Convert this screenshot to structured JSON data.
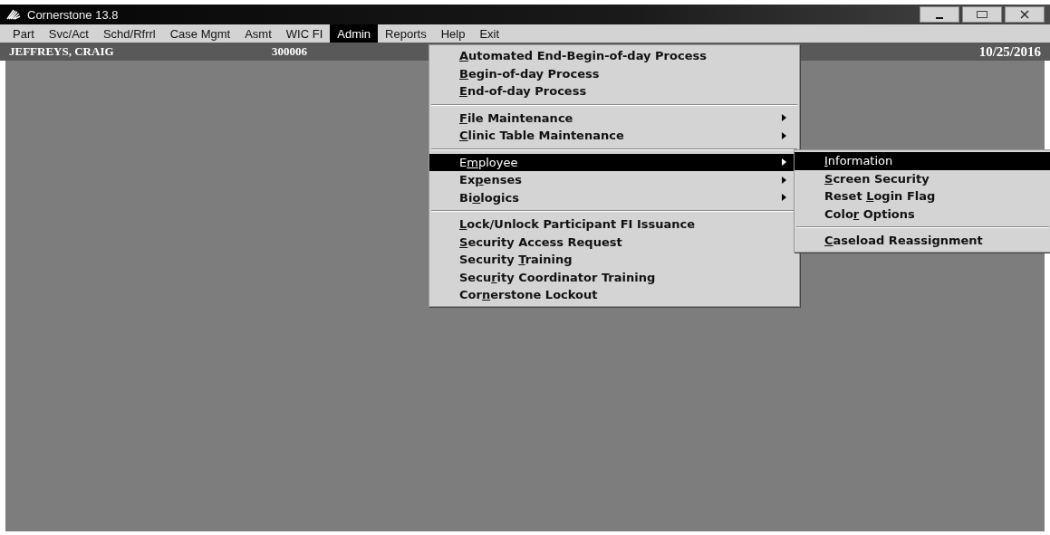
{
  "window": {
    "title": "Cornerstone 13.8"
  },
  "menu_bar": [
    {
      "label": "Part",
      "selected": false
    },
    {
      "label": "Svc/Act",
      "selected": false
    },
    {
      "label": "Schd/Rfrrl",
      "selected": false
    },
    {
      "label": "Case Mgmt",
      "selected": false
    },
    {
      "label": "Asmt",
      "selected": false
    },
    {
      "label": "WIC FI",
      "selected": false
    },
    {
      "label": "Admin",
      "selected": true
    },
    {
      "label": "Reports",
      "selected": false
    },
    {
      "label": "Help",
      "selected": false
    },
    {
      "label": "Exit",
      "selected": false
    }
  ],
  "status_bar": {
    "name": "JEFFREYS, CRAIG",
    "id": "300006",
    "date": "10/25/2016"
  },
  "admin_menu": [
    {
      "kind": "item",
      "key": "A",
      "post": "utomated End-Begin-of-day Process",
      "submenu": false,
      "selected": false
    },
    {
      "kind": "item",
      "key": "B",
      "post": "egin-of-day Process",
      "submenu": false,
      "selected": false
    },
    {
      "kind": "item",
      "key": "E",
      "post": "nd-of-day Process",
      "submenu": false,
      "selected": false
    },
    {
      "kind": "separator"
    },
    {
      "kind": "item",
      "key": "F",
      "post": "ile Maintenance",
      "submenu": true,
      "selected": false
    },
    {
      "kind": "item",
      "key": "C",
      "post": "linic Table Maintenance",
      "submenu": true,
      "selected": false
    },
    {
      "kind": "separator"
    },
    {
      "kind": "item",
      "pre": "E",
      "key": "m",
      "post": "ployee",
      "submenu": true,
      "selected": true
    },
    {
      "kind": "item",
      "pre": "Ex",
      "key": "p",
      "post": "enses",
      "submenu": true,
      "selected": false
    },
    {
      "kind": "item",
      "pre": "Bi",
      "key": "o",
      "post": "logics",
      "submenu": true,
      "selected": false
    },
    {
      "kind": "separator"
    },
    {
      "kind": "item",
      "key": "L",
      "post": "ock/Unlock Participant FI Issuance",
      "submenu": false,
      "selected": false
    },
    {
      "kind": "item",
      "key": "S",
      "post": "ecurity Access Request",
      "submenu": false,
      "selected": false
    },
    {
      "kind": "item",
      "pre": "Security ",
      "key": "T",
      "post": "raining",
      "submenu": false,
      "selected": false
    },
    {
      "kind": "item",
      "pre": "Secu",
      "key": "r",
      "post": "ity Coordinator Training",
      "submenu": false,
      "selected": false
    },
    {
      "kind": "item",
      "pre": "Cor",
      "key": "n",
      "post": "erstone Lockout",
      "submenu": false,
      "selected": false
    }
  ],
  "employee_submenu": [
    {
      "kind": "item",
      "key": "I",
      "post": "nformation",
      "selected": true
    },
    {
      "kind": "item",
      "key": "S",
      "post": "creen Security",
      "selected": false
    },
    {
      "kind": "item",
      "pre": "Reset ",
      "key": "L",
      "post": "ogin Flag",
      "selected": false
    },
    {
      "kind": "item",
      "pre": "Colo",
      "key": "r",
      "post": " Options",
      "selected": false
    },
    {
      "kind": "separator"
    },
    {
      "kind": "item",
      "key": "C",
      "post": "aseload Reassignment",
      "selected": false
    }
  ]
}
